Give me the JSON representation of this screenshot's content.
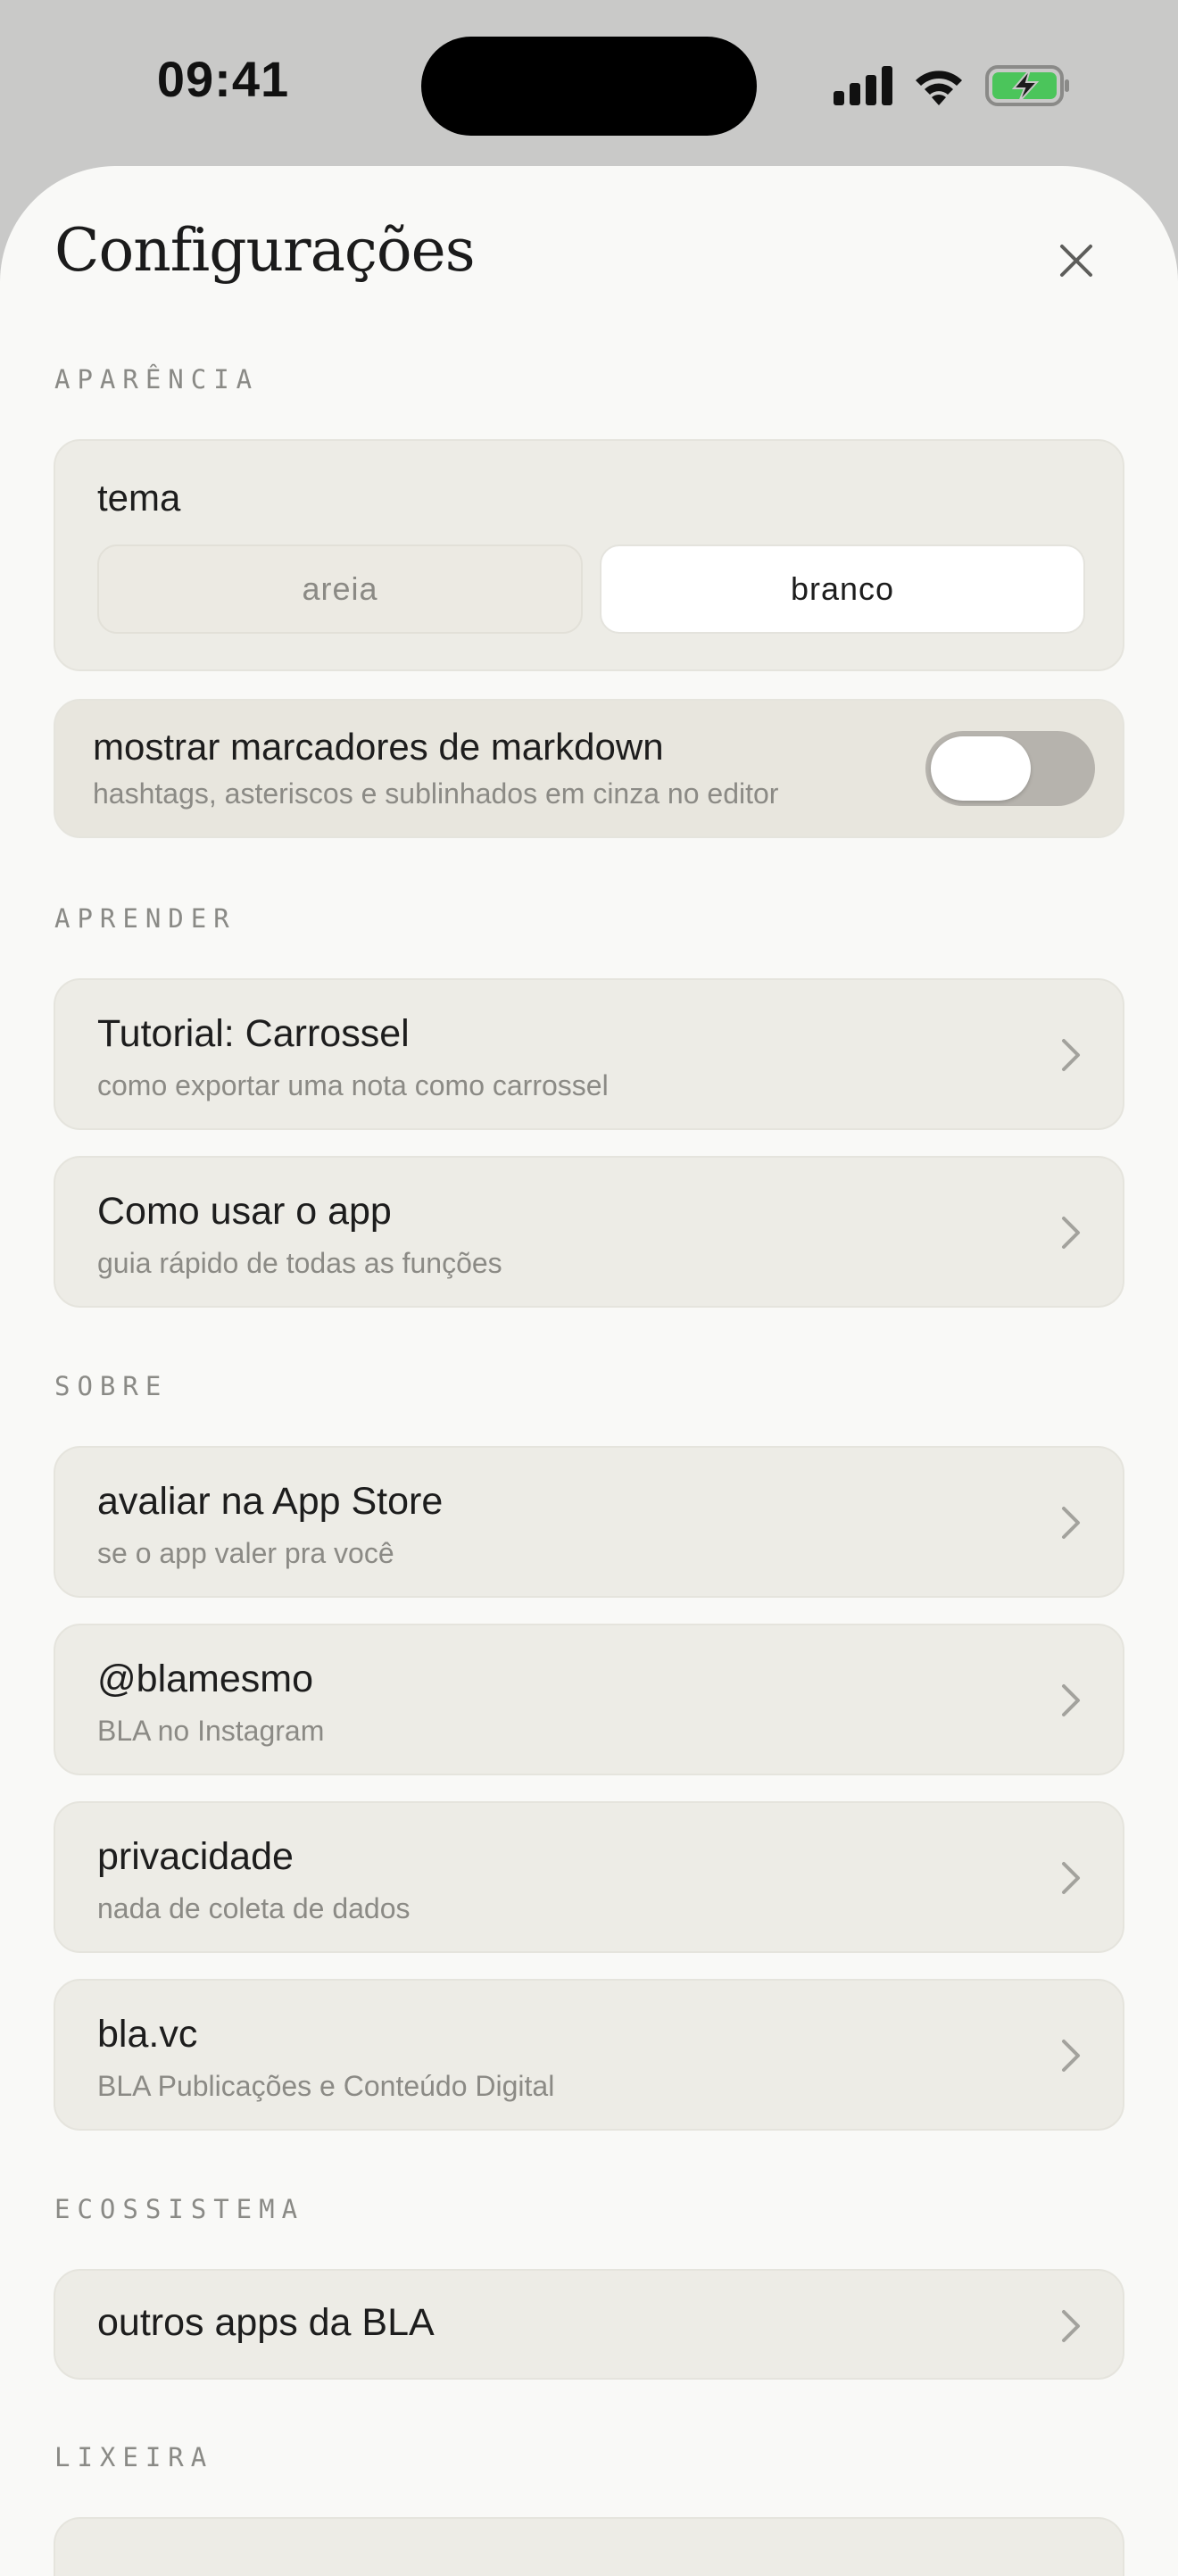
{
  "status_bar": {
    "time": "09:41"
  },
  "header": {
    "title": "Configurações"
  },
  "sections": {
    "appearance": {
      "label": "APARÊNCIA",
      "theme": {
        "label": "tema",
        "options": [
          "areia",
          "branco"
        ],
        "selected": "branco"
      },
      "markdown": {
        "title": "mostrar marcadores de markdown",
        "subtitle": "hashtags, asteriscos e sublinhados em cinza no editor",
        "enabled": false
      }
    },
    "learn": {
      "label": "APRENDER",
      "items": [
        {
          "title": "Tutorial: Carrossel",
          "subtitle": "como exportar uma nota como carrossel"
        },
        {
          "title": "Como usar o app",
          "subtitle": "guia rápido de todas as funções"
        }
      ]
    },
    "about": {
      "label": "SOBRE",
      "items": [
        {
          "title": "avaliar na App Store",
          "subtitle": "se o app valer pra você"
        },
        {
          "title": "@blamesmo",
          "subtitle": "BLA no Instagram"
        },
        {
          "title": "privacidade",
          "subtitle": "nada de coleta de dados"
        },
        {
          "title": "bla.vc",
          "subtitle": "BLA Publicações e Conteúdo Digital"
        }
      ]
    },
    "ecosystem": {
      "label": "ECOSSISTEMA",
      "items": [
        {
          "title": "outros apps da BLA"
        }
      ]
    },
    "trash": {
      "label": "LIXEIRA"
    }
  },
  "colors": {
    "background": "#f9f9f7",
    "card": "#edece6",
    "toggle_off": "#b6b3ad",
    "battery_green": "#4bc55b"
  },
  "icons": {
    "close": "close-icon",
    "chevron": "chevron-right-icon",
    "signal": "cellular-signal-icon",
    "wifi": "wifi-icon",
    "battery": "battery-charging-icon"
  }
}
